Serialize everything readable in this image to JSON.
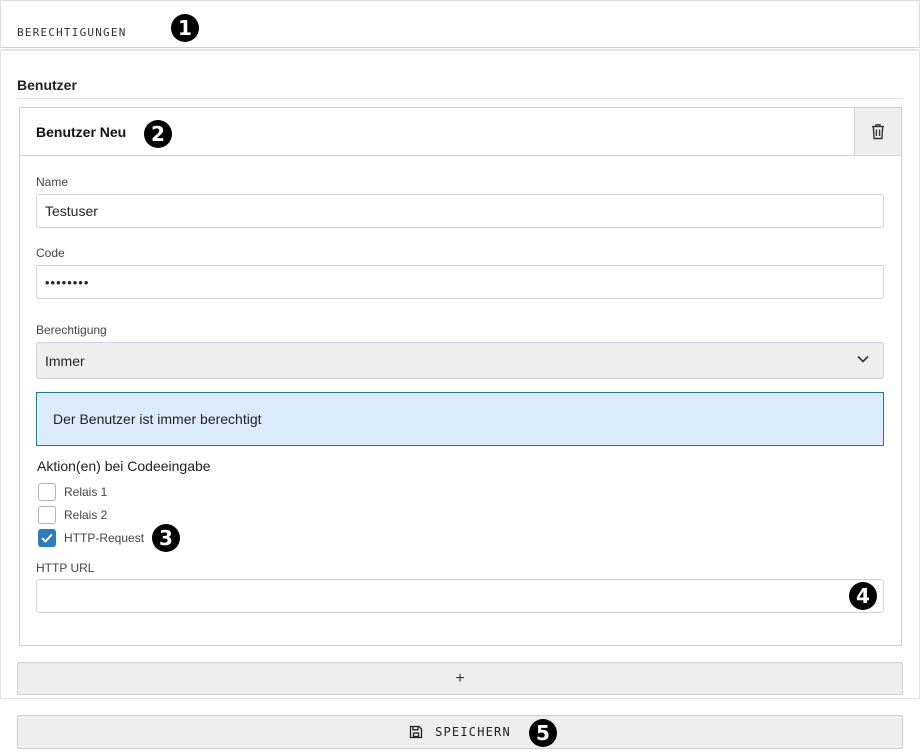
{
  "header": {
    "title": "BERECHTIGUNGEN"
  },
  "section": {
    "title": "Benutzer"
  },
  "user_card": {
    "title": "Benutzer Neu",
    "name_label": "Name",
    "name_value": "Testuser",
    "code_label": "Code",
    "code_value": "••••••••",
    "permission_label": "Berechtigung",
    "permission_value": "Immer",
    "info_text": "Der Benutzer ist immer berechtigt",
    "actions_title": "Aktion(en) bei Codeeingabe",
    "checkboxes": [
      {
        "label": "Relais 1",
        "checked": false
      },
      {
        "label": "Relais 2",
        "checked": false
      },
      {
        "label": "HTTP-Request",
        "checked": true
      }
    ],
    "http_url_label": "HTTP URL",
    "http_url_value": ""
  },
  "add_button": {
    "label": "+"
  },
  "save_button": {
    "label": "SPEICHERN"
  },
  "callouts": [
    "1",
    "2",
    "3",
    "4",
    "5"
  ],
  "icons": {
    "trash": "trash-icon",
    "chevron": "chevron-down-icon",
    "check": "check-icon",
    "save": "floppy-disk-icon"
  },
  "colors": {
    "checkbox_checked": "#2f7bbd",
    "info_background": "#dcebfb",
    "info_border": "#1f7a8c",
    "button_background": "#eeeef0"
  }
}
